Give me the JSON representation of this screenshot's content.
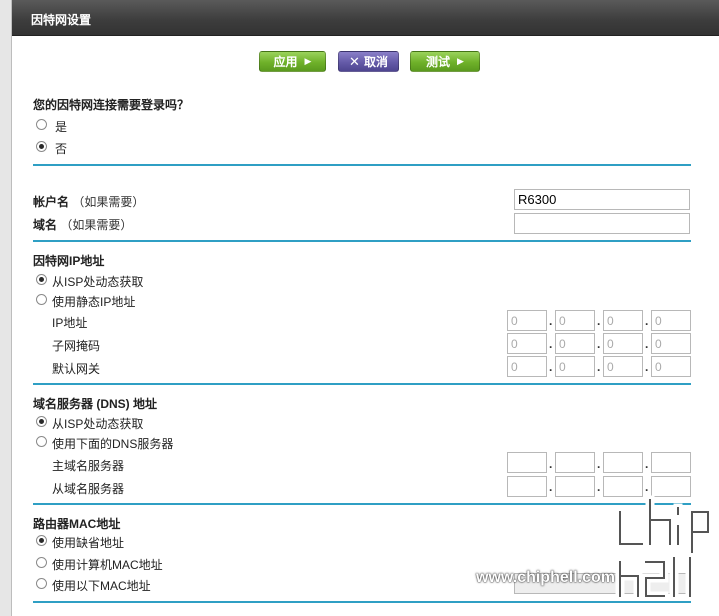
{
  "page": {
    "title": "因特网设置"
  },
  "toolbar": {
    "apply_label": "应用",
    "cancel_label": "取消",
    "test_label": "测试"
  },
  "login": {
    "question": "您的因特网连接需要登录吗？",
    "options": [
      {
        "label": "是",
        "selected": false
      },
      {
        "label": "否",
        "selected": true
      }
    ]
  },
  "account": {
    "name_label": "帐户名",
    "name_hint": "（如果需要）",
    "name_value": "R6300",
    "domain_label": "域名",
    "domain_hint": "（如果需要）",
    "domain_value": ""
  },
  "ip": {
    "section_title": "因特网IP地址",
    "options": [
      {
        "label": "从ISP处动态获取",
        "selected": true
      },
      {
        "label": "使用静态IP地址",
        "selected": false
      }
    ],
    "fields": [
      {
        "label": "IP地址",
        "octets": [
          "0",
          "0",
          "0",
          "0"
        ]
      },
      {
        "label": "子网掩码",
        "octets": [
          "0",
          "0",
          "0",
          "0"
        ]
      },
      {
        "label": "默认网关",
        "octets": [
          "0",
          "0",
          "0",
          "0"
        ]
      }
    ]
  },
  "dns": {
    "section_title": "域名服务器 (DNS) 地址",
    "options": [
      {
        "label": "从ISP处动态获取",
        "selected": true
      },
      {
        "label": "使用下面的DNS服务器",
        "selected": false
      }
    ],
    "fields": [
      {
        "label": "主域名服务器",
        "octets": [
          "",
          "",
          "",
          ""
        ]
      },
      {
        "label": "从域名服务器",
        "octets": [
          "",
          "",
          "",
          ""
        ]
      }
    ]
  },
  "mac": {
    "section_title": "路由器MAC地址",
    "options": [
      {
        "label": "使用缺省地址",
        "selected": true
      },
      {
        "label": "使用计算机MAC地址",
        "selected": false
      },
      {
        "label": "使用以下MAC地址",
        "selected": false
      }
    ]
  },
  "watermark": {
    "text": "www.chiphell.com"
  },
  "colors": {
    "accent_line": "#2f9fc4",
    "button_green": "#6fb12a",
    "button_purple": "#645aa8",
    "titlebar": "#3c3c3c"
  }
}
